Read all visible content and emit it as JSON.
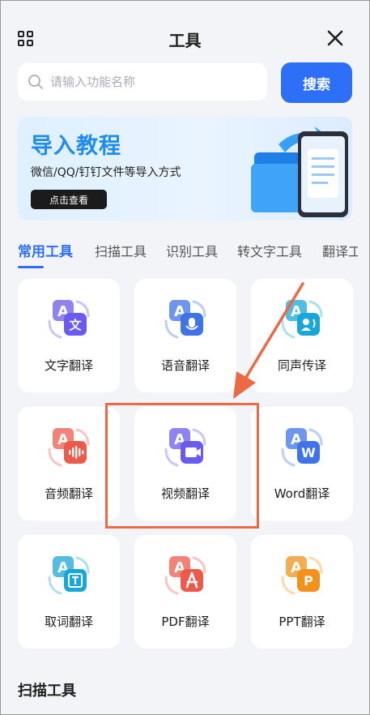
{
  "header": {
    "title": "工具"
  },
  "search": {
    "placeholder": "请输入功能名称",
    "button_label": "搜索"
  },
  "banner": {
    "title": "导入教程",
    "subtitle": "微信/QQ/钉钉文件等导入方式",
    "button_label": "点击查看"
  },
  "tabs": [
    "常用工具",
    "扫描工具",
    "识别工具",
    "转文字工具",
    "翻译工"
  ],
  "tools": [
    {
      "label": "文字翻译",
      "icon": "text-translate-icon",
      "badge": "文",
      "color": "#6a5af0"
    },
    {
      "label": "语音翻译",
      "icon": "voice-translate-icon",
      "badge": "mic",
      "color": "#3f73e8"
    },
    {
      "label": "同声传译",
      "icon": "simultaneous-interpretation-icon",
      "badge": "speaker",
      "color": "#19a6d8"
    },
    {
      "label": "音频翻译",
      "icon": "audio-translate-icon",
      "badge": "wave",
      "color": "#ee5a4a"
    },
    {
      "label": "视频翻译",
      "icon": "video-translate-icon",
      "badge": "video",
      "color": "#6a5af0"
    },
    {
      "label": "Word翻译",
      "icon": "word-translate-icon",
      "badge": "W",
      "color": "#3f73e8"
    },
    {
      "label": "取词翻译",
      "icon": "word-capture-translate-icon",
      "badge": "T",
      "color": "#19a6d8"
    },
    {
      "label": "PDF翻译",
      "icon": "pdf-translate-icon",
      "badge": "pdf",
      "color": "#ee5a4a"
    },
    {
      "label": "PPT翻译",
      "icon": "ppt-translate-icon",
      "badge": "P",
      "color": "#f2911b"
    }
  ],
  "section": {
    "title": "扫描工具"
  },
  "colors": {
    "accent": "#2d6ff7",
    "highlight": "#e96a45",
    "background": "#f3f4f7"
  }
}
